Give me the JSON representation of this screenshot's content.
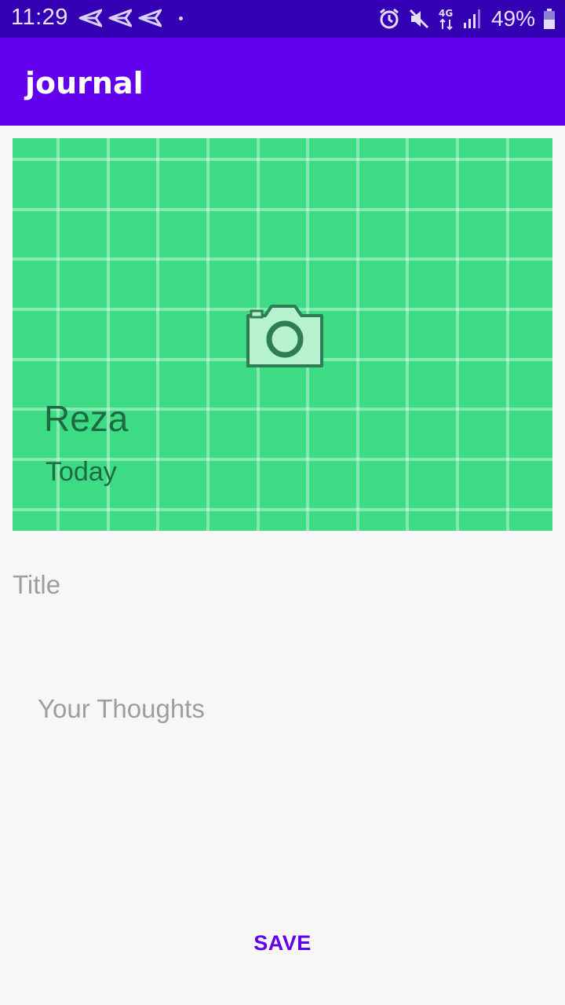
{
  "status_bar": {
    "time": "11:29",
    "battery": "49%",
    "network": "4G",
    "icons": [
      "send-icon",
      "send-icon",
      "send-icon",
      "alarm-icon",
      "mute-icon",
      "network-icon",
      "signal-icon",
      "battery-icon"
    ],
    "background": "#3300b3"
  },
  "app_bar": {
    "title": "journal",
    "background": "#6200ee"
  },
  "card": {
    "name": "Reza",
    "date": "Today",
    "background": "#3ddc84",
    "icon": "camera-icon"
  },
  "form": {
    "title_placeholder": "Title",
    "thoughts_placeholder": "Your Thoughts",
    "title_value": "",
    "thoughts_value": ""
  },
  "actions": {
    "save_label": "SAVE",
    "accent": "#6200ee"
  }
}
